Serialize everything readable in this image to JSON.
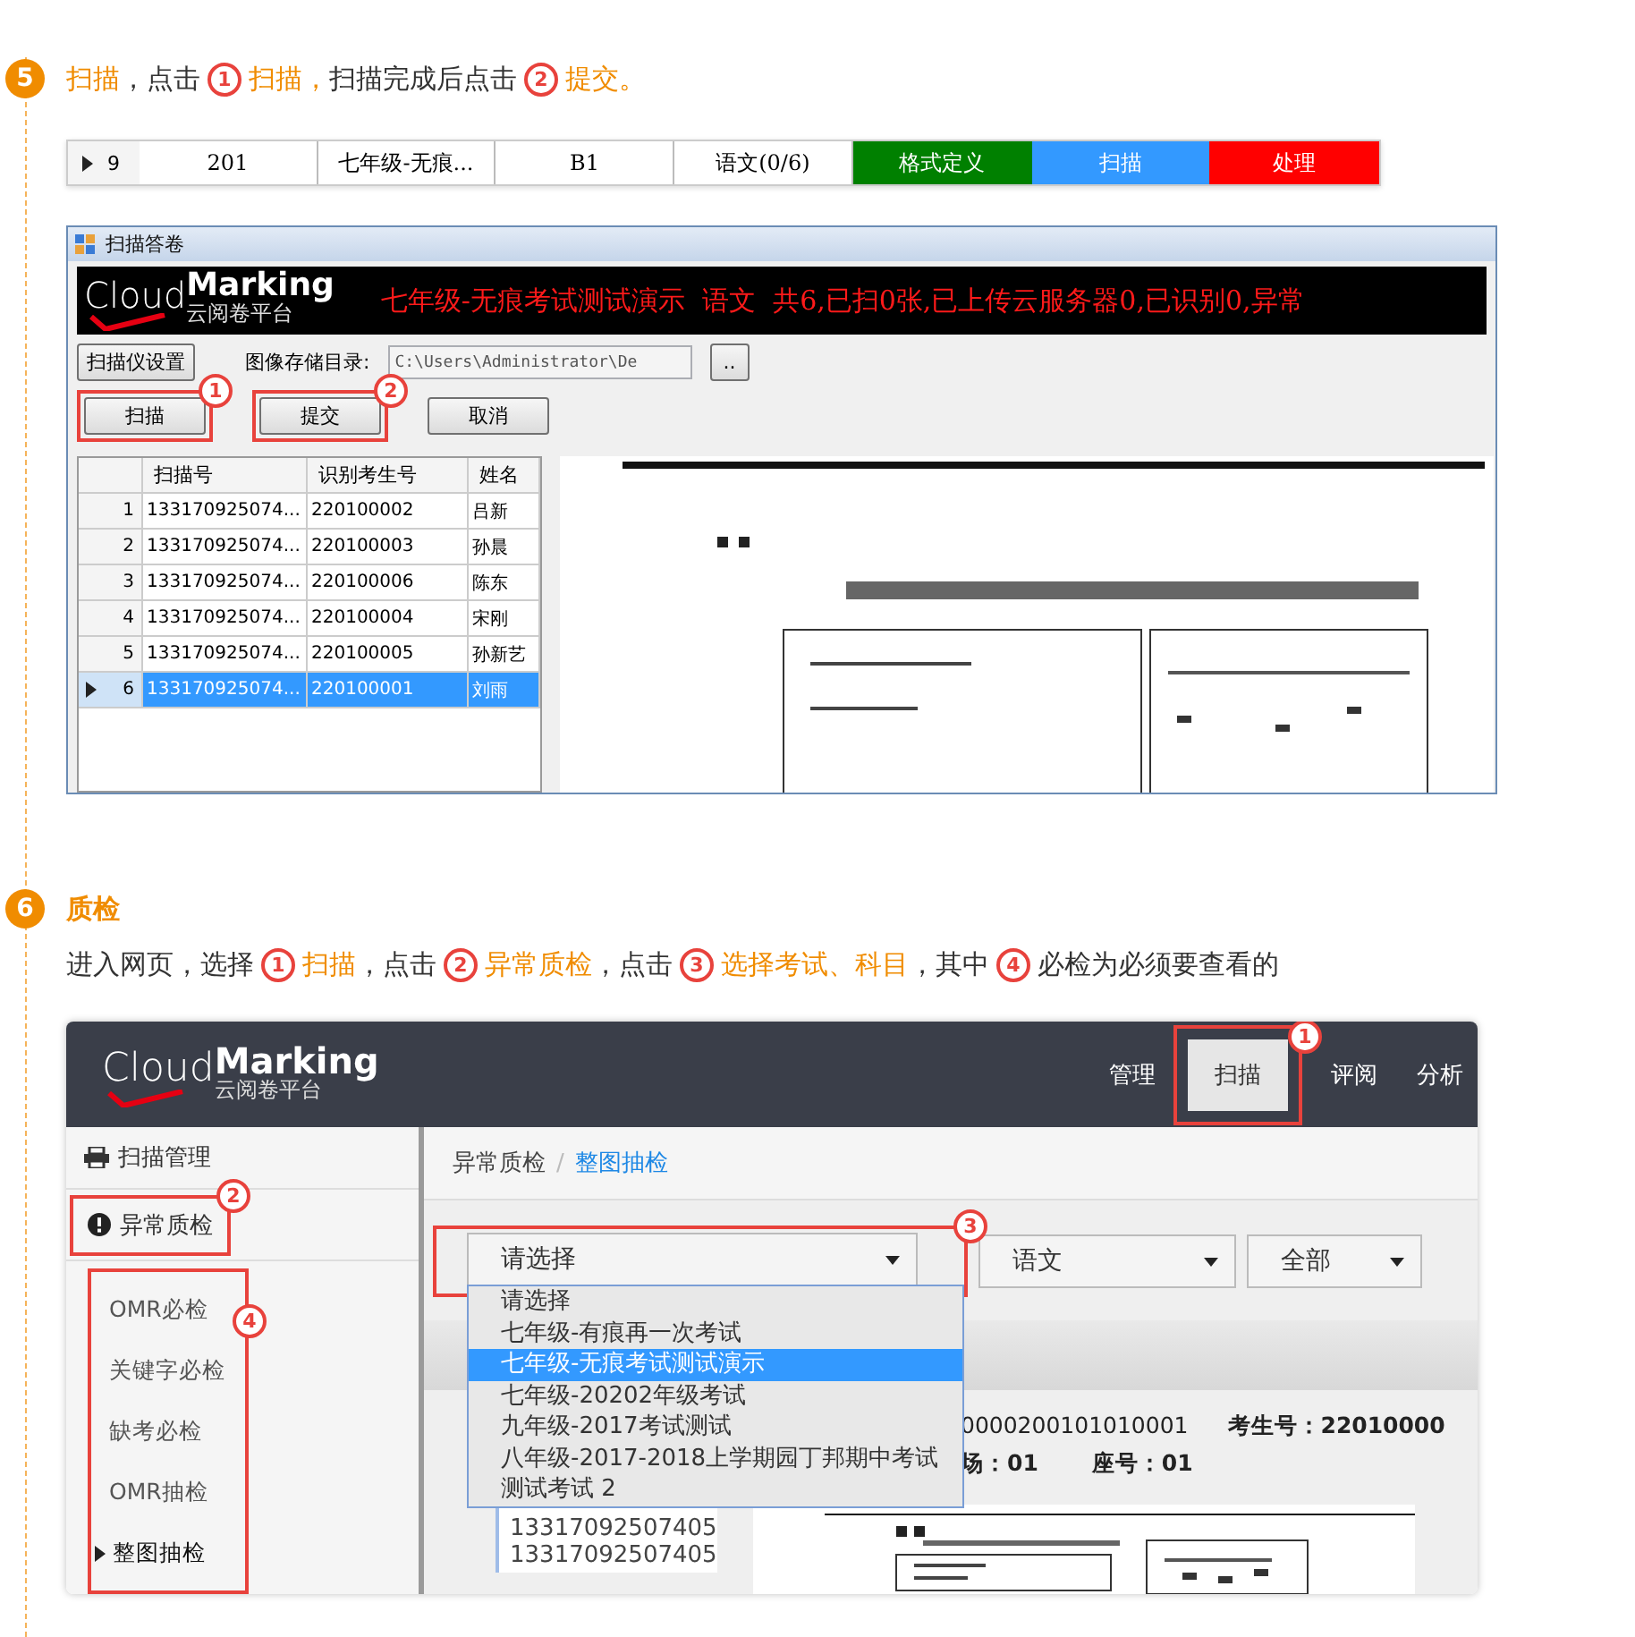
{
  "steps": [
    {
      "number": "5",
      "instruction": [
        {
          "kind": "text",
          "text": "扫描",
          "accent": true
        },
        {
          "kind": "text",
          "text": "，点击",
          "accent": false
        },
        {
          "kind": "marker",
          "text": "1"
        },
        {
          "kind": "text",
          "text": "扫描，",
          "accent": true
        },
        {
          "kind": "text",
          "text": "扫描完成后点击",
          "accent": false
        },
        {
          "kind": "marker",
          "text": "2"
        },
        {
          "kind": "text",
          "text": "提交。",
          "accent": true
        }
      ],
      "task_row": {
        "cells": [
          "9",
          "201",
          "七年级-无痕...",
          "B1",
          "语文(0/6)"
        ],
        "actions": [
          {
            "label": "格式定义",
            "color": "#008000"
          },
          {
            "label": "扫描",
            "color": "#3399ff"
          },
          {
            "label": "处理",
            "color": "#ff0000"
          }
        ]
      },
      "scanner_window": {
        "title": "扫描答卷",
        "logo": {
          "word1": "Cloud",
          "word2": "Marking",
          "tagline": "云阅卷平台"
        },
        "banner_text": "七年级-无痕考试测试演示  语文  共6,已扫0张,已上传云服务器0,已识别0,异常",
        "settings_button": "扫描仪设置",
        "dir_label": "图像存储目录:",
        "dir_value": "C:\\Users\\Administrator\\De",
        "browse_button": "..",
        "buttons": [
          {
            "label": "扫描",
            "marker": "1"
          },
          {
            "label": "提交",
            "marker": "2"
          },
          {
            "label": "取消"
          }
        ],
        "columns": [
          "扫描号",
          "识别考生号",
          "姓名"
        ],
        "rows": [
          {
            "index": "1",
            "cells": [
              "133170925074...",
              "220100002",
              "吕新"
            ],
            "selected": false
          },
          {
            "index": "2",
            "cells": [
              "133170925074...",
              "220100003",
              "孙晨"
            ],
            "selected": false
          },
          {
            "index": "3",
            "cells": [
              "133170925074...",
              "220100006",
              "陈东"
            ],
            "selected": false
          },
          {
            "index": "4",
            "cells": [
              "133170925074...",
              "220100004",
              "宋刚"
            ],
            "selected": false
          },
          {
            "index": "5",
            "cells": [
              "133170925074...",
              "220100005",
              "孙新艺"
            ],
            "selected": false
          },
          {
            "index": "6",
            "cells": [
              "133170925074...",
              "220100001",
              "刘雨"
            ],
            "selected": true
          }
        ]
      }
    },
    {
      "number": "6",
      "title": "质检",
      "instruction": [
        {
          "kind": "text",
          "text": "进入网页，选择",
          "accent": false
        },
        {
          "kind": "marker",
          "text": "1"
        },
        {
          "kind": "text",
          "text": "扫描",
          "accent": true
        },
        {
          "kind": "text",
          "text": "，点击",
          "accent": false
        },
        {
          "kind": "marker",
          "text": "2"
        },
        {
          "kind": "text",
          "text": "异常质检",
          "accent": true
        },
        {
          "kind": "text",
          "text": "，点击",
          "accent": false
        },
        {
          "kind": "marker",
          "text": "3"
        },
        {
          "kind": "text",
          "text": "选择考试、科目",
          "accent": true
        },
        {
          "kind": "text",
          "text": "，其中",
          "accent": false
        },
        {
          "kind": "marker",
          "text": "4"
        },
        {
          "kind": "text",
          "text": "必检为必须要查看的",
          "accent": false
        }
      ],
      "web_app": {
        "logo": {
          "word1": "Cloud",
          "word2": "Marking",
          "tagline": "云阅卷平台"
        },
        "nav": [
          {
            "label": "管理",
            "selected": false
          },
          {
            "label": "扫描",
            "selected": true,
            "marker": "1"
          },
          {
            "label": "评阅",
            "selected": false
          },
          {
            "label": "分析",
            "selected": false
          }
        ],
        "sidebar": [
          {
            "label": "扫描管理"
          },
          {
            "label": "异常质检",
            "marker": "2"
          }
        ],
        "submenu": {
          "marker": "4",
          "items": [
            {
              "label": "OMR必检",
              "selected": false
            },
            {
              "label": "关键字必检",
              "selected": false
            },
            {
              "label": "缺考必检",
              "selected": false
            },
            {
              "label": "OMR抽检",
              "selected": false
            },
            {
              "label": "整图抽检",
              "selected": true
            }
          ]
        },
        "breadcrumb": [
          "异常质检",
          "整图抽检"
        ],
        "breadcrumb_separator": "/",
        "selects": [
          {
            "value": "请选择",
            "marker": "3"
          },
          {
            "value": "语文"
          },
          {
            "value": "全部"
          }
        ],
        "dropdown": [
          {
            "label": "请选择",
            "selected": false
          },
          {
            "label": "七年级-有痕再一次考试",
            "selected": false
          },
          {
            "label": "七年级-无痕考试测试演示",
            "selected": true
          },
          {
            "label": "七年级-20202年级考试",
            "selected": false
          },
          {
            "label": "九年级-2017考试测试",
            "selected": false
          },
          {
            "label": "八年级-2017-2018上学期园丁邦期中考试",
            "selected": false
          },
          {
            "label": "测试考试 2",
            "selected": false
          }
        ],
        "record": {
          "exam_no": "0000200101010001",
          "student": "考生号：22010000",
          "room": "场：01",
          "seat": "座号：01"
        },
        "scan_list": [
          "13317092507405",
          "13317092507405"
        ]
      }
    }
  ]
}
